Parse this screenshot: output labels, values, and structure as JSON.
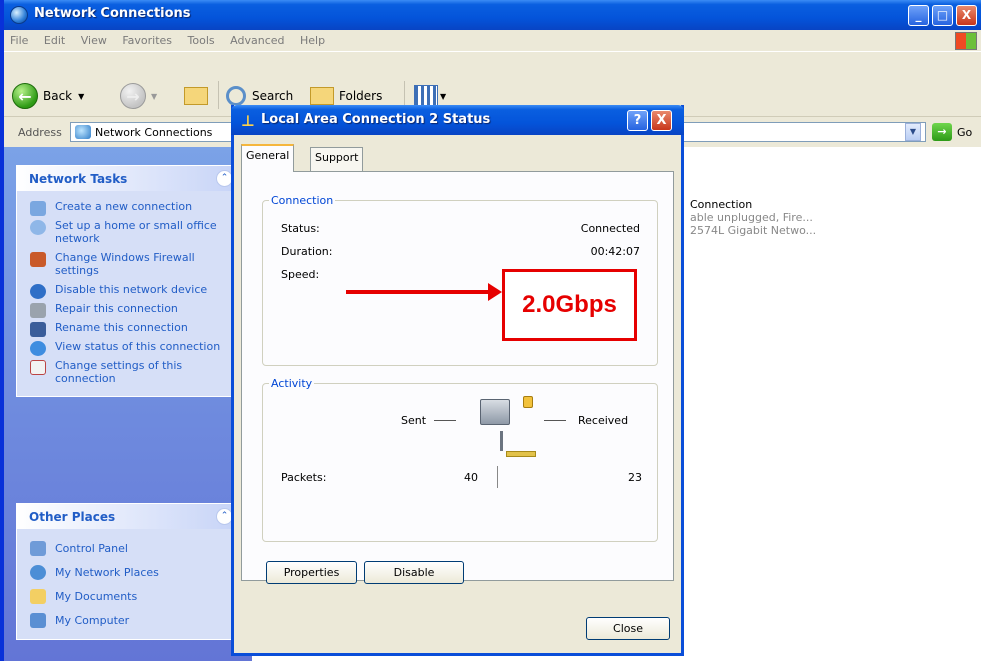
{
  "window": {
    "title": "Network Connections",
    "controls": {
      "minimize": "_",
      "maximize": "□",
      "close": "X"
    }
  },
  "menu": [
    "File",
    "Edit",
    "View",
    "Favorites",
    "Tools",
    "Advanced",
    "Help"
  ],
  "toolbar": {
    "back": "Back",
    "search": "Search",
    "folders": "Folders"
  },
  "address": {
    "label": "Address",
    "value": "Network Connections",
    "go": "Go"
  },
  "network_tasks": {
    "title": "Network Tasks",
    "items": [
      {
        "label": "Create a new connection",
        "icon": "new-connection-icon"
      },
      {
        "label": "Set up a home or small office network",
        "icon": "home-network-icon"
      },
      {
        "label": "Change Windows Firewall settings",
        "icon": "firewall-icon"
      },
      {
        "label": "Disable this network device",
        "icon": "disable-network-icon"
      },
      {
        "label": "Repair this connection",
        "icon": "repair-icon"
      },
      {
        "label": "Rename this connection",
        "icon": "rename-icon"
      },
      {
        "label": "View status of this connection",
        "icon": "status-icon"
      },
      {
        "label": "Change settings of this connection",
        "icon": "settings-icon"
      }
    ]
  },
  "other_places": {
    "title": "Other Places",
    "items": [
      {
        "label": "Control Panel",
        "icon": "control-panel-icon"
      },
      {
        "label": "My Network Places",
        "icon": "network-places-icon"
      },
      {
        "label": "My Documents",
        "icon": "documents-icon"
      },
      {
        "label": "My Computer",
        "icon": "computer-icon"
      }
    ]
  },
  "connection_list": {
    "name": "Connection",
    "line2": "able unplugged, Fire...",
    "line3": "2574L Gigabit Netwo..."
  },
  "dialog": {
    "title": "Local Area Connection 2 Status",
    "help": "?",
    "close_x": "X",
    "tabs": [
      "General",
      "Support"
    ],
    "connection": {
      "legend": "Connection",
      "status_label": "Status:",
      "status_value": "Connected",
      "duration_label": "Duration:",
      "duration_value": "00:42:07",
      "speed_label": "Speed:"
    },
    "activity": {
      "legend": "Activity",
      "sent": "Sent",
      "received": "Received",
      "packets_label": "Packets:",
      "packets_sent": "40",
      "packets_received": "23"
    },
    "buttons": {
      "properties": "Properties",
      "disable": "Disable",
      "close": "Close"
    }
  },
  "annotation": {
    "callout": "2.0Gbps",
    "color": "#e60000"
  }
}
